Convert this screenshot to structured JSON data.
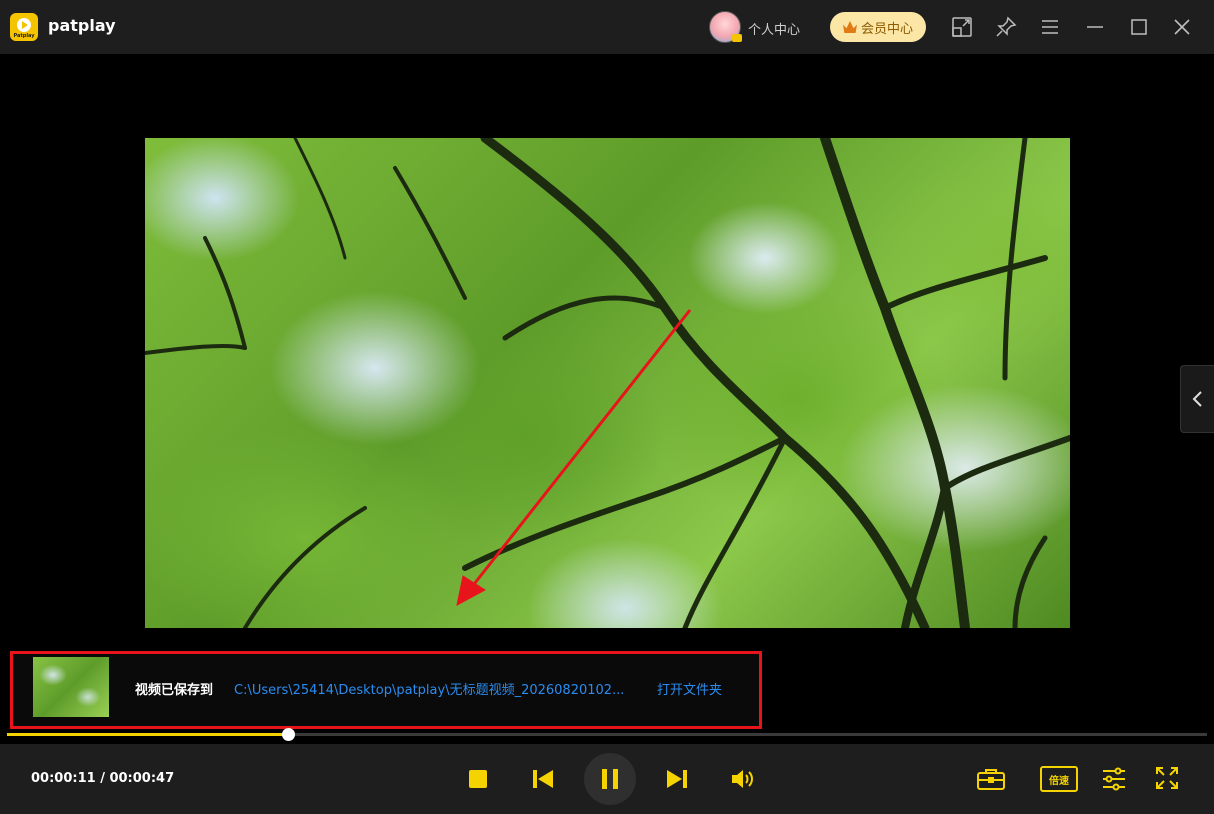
{
  "app": {
    "name": "patplay",
    "logo_text": "Patplay"
  },
  "header": {
    "personal_center": "个人中心",
    "vip_center": "会员中心"
  },
  "notification": {
    "saved_label": "视频已保存到",
    "saved_path": "C:\\Users\\25414\\Desktop\\patplay\\无标题视频_20260820102...",
    "open_folder": "打开文件夹"
  },
  "player": {
    "current_time": "00:00:11",
    "total_time": "00:00:47",
    "time_display": "00:00:11 / 00:00:47",
    "progress": 0.234,
    "speed_label": "倍速"
  },
  "colors": {
    "accent": "#f5d300",
    "link": "#2b8cf0",
    "highlight_box": "#e8141b",
    "annotation_arrow": "#e8141b"
  },
  "icons": {
    "logo": "patplay-logo-icon",
    "avatar": "user-avatar",
    "vip": "crown-icon",
    "mini_mode": "mini-mode-icon",
    "pin": "pin-icon",
    "menu": "hamburger-menu-icon",
    "minimize": "minimize-icon",
    "maximize": "maximize-icon",
    "close": "close-icon",
    "side_panel": "chevron-left-icon",
    "stop": "stop-icon",
    "previous": "skip-previous-icon",
    "pause": "pause-icon",
    "next": "skip-next-icon",
    "volume": "volume-icon",
    "toolbox": "toolbox-icon",
    "equalizer": "settings-sliders-icon",
    "fullscreen": "fullscreen-icon"
  }
}
